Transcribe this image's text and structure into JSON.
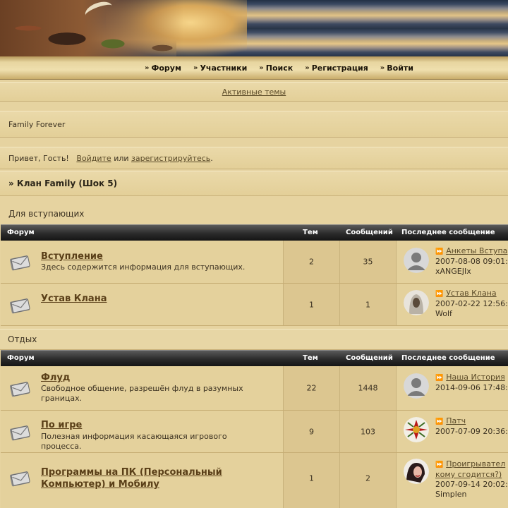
{
  "nav": {
    "items": [
      "Форум",
      "Участники",
      "Поиск",
      "Регистрация",
      "Войти"
    ]
  },
  "active_topics": "Активные темы",
  "site_title": "Family Forever",
  "greeting": {
    "prefix": "Привет, Гость!",
    "login": "Войдите",
    "or": "или",
    "register": "зарегистрируйтесь",
    "suffix": "."
  },
  "breadcrumb": "» Клан Family (Шок 5)",
  "columns": {
    "forum": "Форум",
    "topics": "Тем",
    "posts": "Сообщений",
    "last_post": "Последнее сообщение"
  },
  "sections": [
    {
      "title": "Для вступающих",
      "forums": [
        {
          "title": "Вступление",
          "desc": "Здесь содержится информация для вступающих.",
          "topics": "2",
          "posts": "35",
          "last_topic": "Анкеты Вступа",
          "last_date": "2007-08-08 09:01:",
          "last_user": "xANGEJIx"
        },
        {
          "title": "Устав Клана",
          "desc": "",
          "topics": "1",
          "posts": "1",
          "last_topic": "Устав Клана",
          "last_date": "2007-02-22 12:56:",
          "last_user": "Wolf"
        }
      ]
    },
    {
      "title": "Отдых",
      "forums": [
        {
          "title": "Флуд",
          "desc": "Свободное общение, разрешён флуд в разумных границах.",
          "topics": "22",
          "posts": "1448",
          "last_topic": "Наша История",
          "last_date": "2014-09-06 17:48:",
          "last_user": ""
        },
        {
          "title": "По игре",
          "desc": "Полезная информация касающаяся игрового процесса.",
          "topics": "9",
          "posts": "103",
          "last_topic": "Патч",
          "last_date": "2007-07-09 20:36:",
          "last_user": ""
        },
        {
          "title": "Программы на ПК (Персональный Компьютер) и Мобилу",
          "desc": "",
          "topics": "1",
          "posts": "2",
          "last_topic": "Проигрывател",
          "last_topic_2": "кому сгодится?)",
          "last_date": "2007-09-14 20:02:",
          "last_user": "Simplen"
        }
      ]
    }
  ],
  "icons": {
    "forum": "envelope-icon",
    "avatar_default": "user-silhouette-icon",
    "last_post": "go-to-post-icon",
    "nav_bullet": "double-chevron-icon"
  }
}
